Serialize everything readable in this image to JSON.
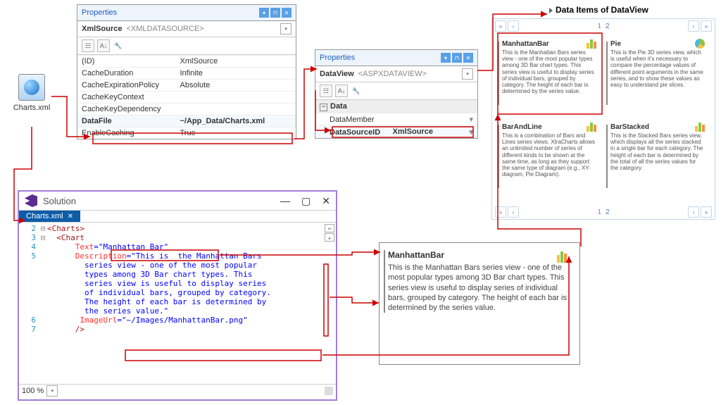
{
  "props1": {
    "title": "Properties",
    "object": "XmlSource",
    "type": "<XMLDATASOURCE>",
    "rows": [
      {
        "k": "(ID)",
        "v": "XmlSource"
      },
      {
        "k": "CacheDuration",
        "v": "Infinite"
      },
      {
        "k": "CacheExpirationPolicy",
        "v": "Absolute"
      },
      {
        "k": "CacheKeyContext",
        "v": ""
      },
      {
        "k": "CacheKeyDependency",
        "v": ""
      },
      {
        "k": "DataFile",
        "v": "~/App_Data/Charts.xml",
        "hl": true,
        "bold": true
      },
      {
        "k": "EnableCaching",
        "v": "True"
      }
    ]
  },
  "props2": {
    "title": "Properties",
    "object": "DataView",
    "type": "<ASPXDATAVIEW>",
    "section": "Data",
    "rows": [
      {
        "k": "DataMember",
        "v": ""
      },
      {
        "k": "DataSourceID",
        "v": "XmlSource",
        "hl": true,
        "bold": true
      }
    ]
  },
  "file": {
    "name": "Charts.xml"
  },
  "vs": {
    "title": "Solution",
    "tab": "Charts.xml",
    "zoom": "100 %",
    "lines": {
      "l2": {
        "tag": "Charts"
      },
      "l3": {
        "tag": "Chart"
      },
      "l4": {
        "attr": "Text",
        "val": "\"Manhattan Bar\""
      },
      "l5": {
        "attr": "Description",
        "parts": [
          "\"This is  the Manhattan Bars",
          " series view - one of the most popular",
          " types among 3D Bar chart types. This",
          " series view is useful to display series",
          " of individual bars, grouped by category.",
          " The height of each bar is determined by",
          " the series value.\""
        ]
      },
      "l6": {
        "attr": "ImageUrl",
        "val": "\"~/Images/ManhattanBar.png\""
      }
    }
  },
  "heading": "Data Items of DataView",
  "dataview": {
    "pages": [
      "1",
      "2"
    ],
    "items": [
      {
        "title": "ManhattanBar",
        "icon": "bars",
        "desc": "This is the Manhattan Bars series view - one of the most popular types among 3D Bar chart types. This series view is useful to display series of individual bars, grouped by category. The height of each bar is determined by the series value."
      },
      {
        "title": "Pie",
        "icon": "pie",
        "desc": "This is the Pie 3D series view, which is useful when it's necessary to compare the percentage values of different point arguments in the same series, and to show these values as easy to understand pie slices."
      },
      {
        "title": "BarAndLine",
        "icon": "bars",
        "desc": "This is a combination of Bars and Lines series views. XtraCharts allows an unlimited number of series of different kinds to be shown at the same time, as long as they support the same type of diagram (e.g., XY-diagram, Pie Diagram)."
      },
      {
        "title": "BarStacked",
        "icon": "bars",
        "desc": "This is the Stacked Bars series view, which displays all the series stacked in a single bar for each category. The height of each bar is determined by the total of all the series values for the category."
      }
    ]
  },
  "detail": {
    "title": "ManhattanBar",
    "desc": "This is the Manhattan Bars series view - one of the most popular types among 3D Bar chart types. This series view is useful to display series of individual bars, grouped by category. The height of each bar is determined by the series value."
  }
}
